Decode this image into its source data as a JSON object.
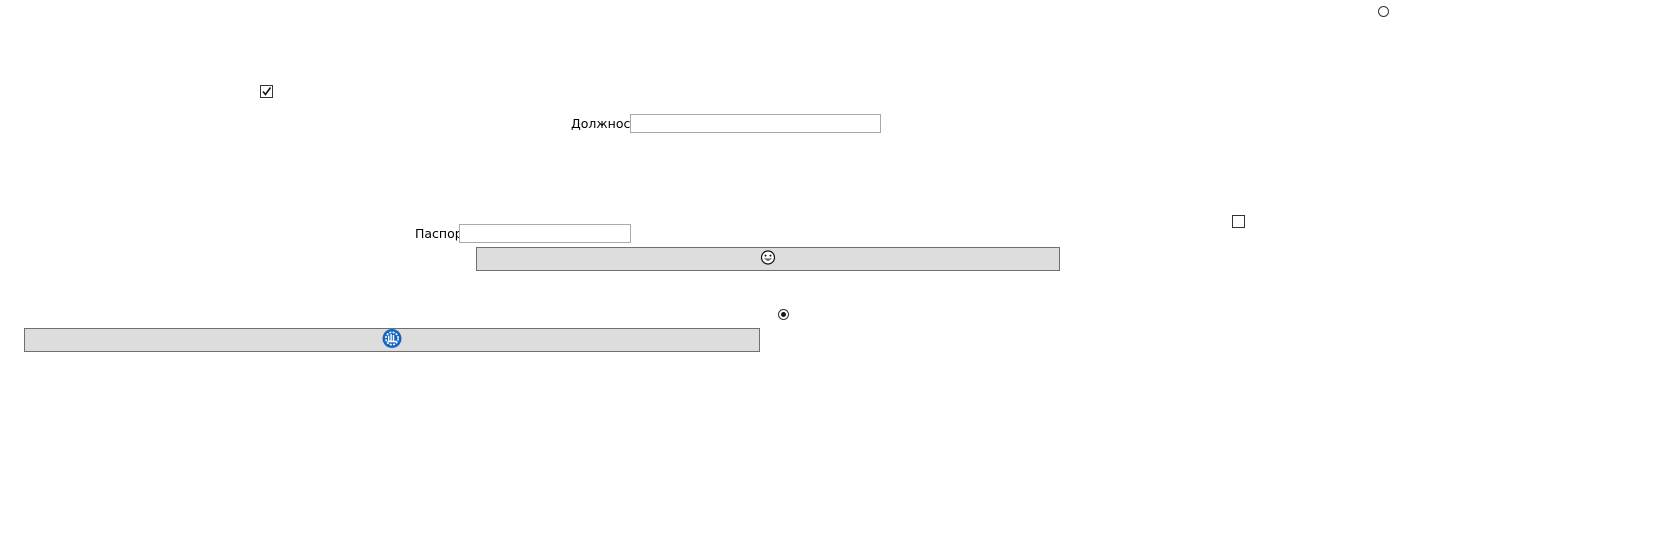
{
  "controls": {
    "radio_top_right": {
      "checked": false
    },
    "checkbox_top_left": {
      "checked": true
    },
    "position_field": {
      "label": "Должность",
      "value": ""
    },
    "checkbox_right": {
      "checked": false
    },
    "passport_field": {
      "label": "Паспорт",
      "value": ""
    },
    "emoji_button": {
      "icon": "grinning-face-icon"
    },
    "radio_center": {
      "checked": true
    },
    "wide_button": {
      "icon": "circle-gear-icon",
      "accent": "#1565c0"
    }
  }
}
